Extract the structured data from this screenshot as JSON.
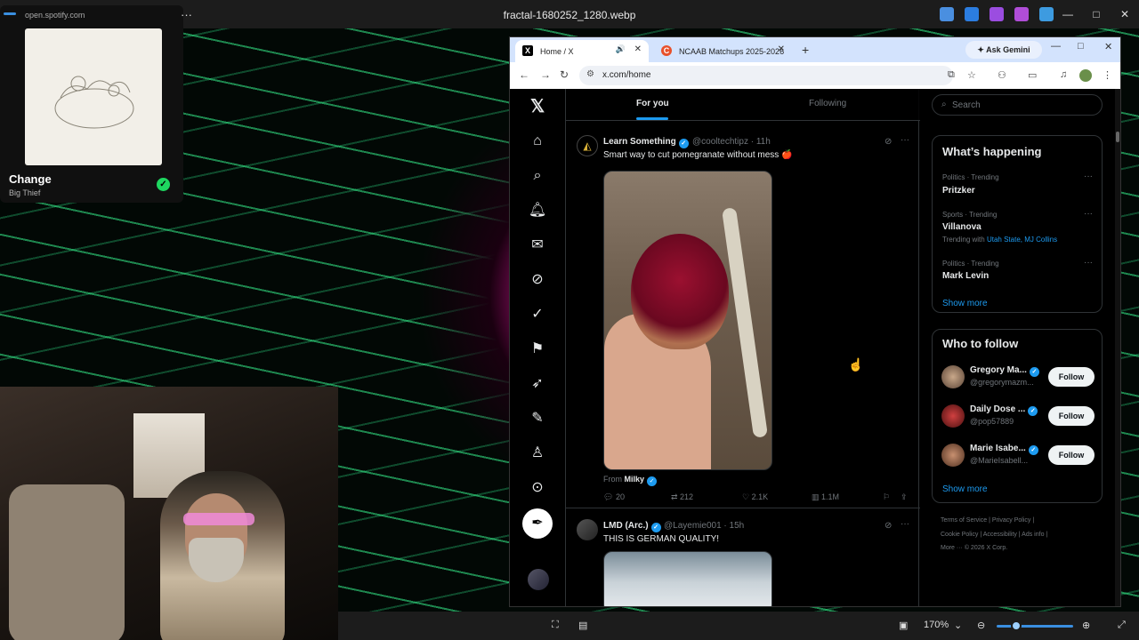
{
  "viewer": {
    "title": "fractal-1680252_1280.webp",
    "zoom": "170%",
    "win_min": "—",
    "win_max": "□",
    "win_close": "✕"
  },
  "spotify": {
    "url": "open.spotify.com",
    "track": "Change",
    "artist": "Big Thief",
    "menu": "···",
    "check": "✓"
  },
  "browser": {
    "tabs": [
      {
        "label": "Home / X",
        "icon": "X"
      },
      {
        "label": "NCAAB Matchups 2025-2026",
        "icon": "C"
      }
    ],
    "new_tab": "+",
    "ask_gemini": "✦ Ask Gemini",
    "url": "x.com/home"
  },
  "x": {
    "tabs": {
      "for_you": "For you",
      "following": "Following"
    },
    "posts": [
      {
        "name": "Learn Something",
        "handle": "@cooltechtipz · 11h",
        "text": "Smart way to cut pomegranate without mess 🍎",
        "from_label": "From",
        "from_name": "Milky",
        "replies": "20",
        "reposts": "212",
        "likes": "2.1K",
        "views": "1.1M"
      },
      {
        "name": "LMD (Arc.)",
        "handle": "@Layemie001 · 15h",
        "text": "THIS IS GERMAN QUALITY!"
      }
    ],
    "search_placeholder": "Search",
    "whats_happening": {
      "title": "What’s happening",
      "trends": [
        {
          "meta": "Politics · Trending",
          "name": "Pritzker"
        },
        {
          "meta": "Sports · Trending",
          "name": "Villanova",
          "with_label": "Trending with",
          "with_links": "Utah State, MJ Collins"
        },
        {
          "meta": "Politics · Trending",
          "name": "Mark Levin"
        }
      ],
      "show_more": "Show more"
    },
    "who_to_follow": {
      "title": "Who to follow",
      "accounts": [
        {
          "name": "Gregory Ma...",
          "handle": "@gregorymazm...",
          "button": "Follow"
        },
        {
          "name": "Daily Dose ...",
          "handle": "@pop57889",
          "button": "Follow"
        },
        {
          "name": "Marie Isabe...",
          "handle": "@MarieIsabell...",
          "button": "Follow"
        }
      ],
      "show_more": "Show more"
    },
    "footer": {
      "line1": "Terms of Service  |  Privacy Policy  |",
      "line2": "Cookie Policy  |  Accessibility  |  Ads info  |",
      "line3": "More ···  © 2026 X Corp."
    }
  }
}
